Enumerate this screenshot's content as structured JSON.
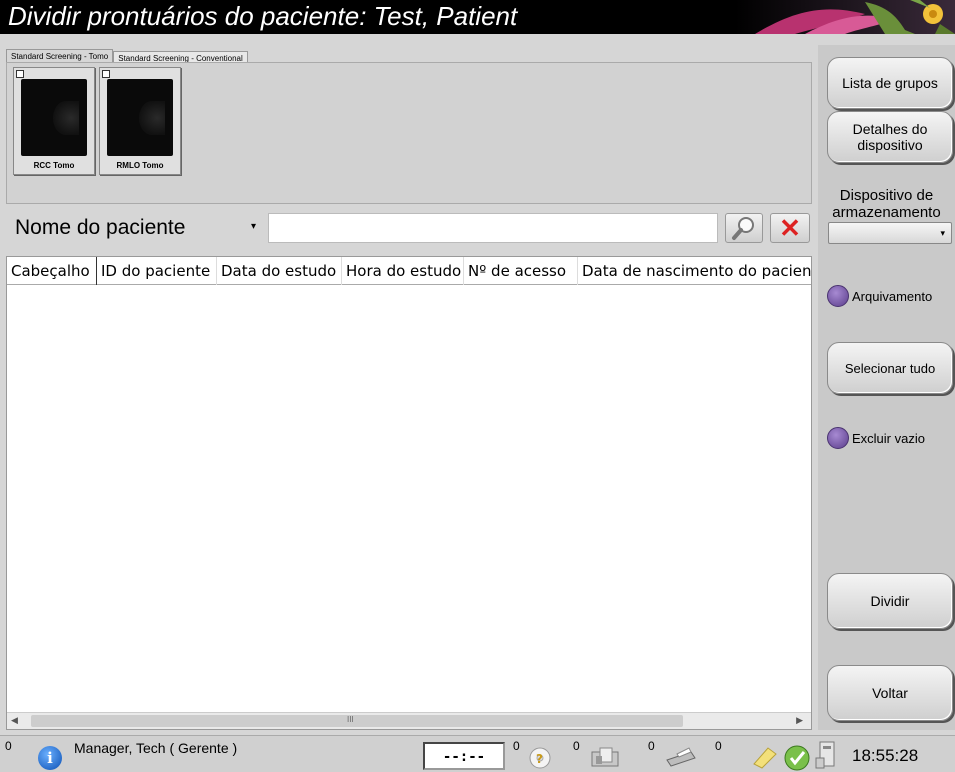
{
  "window": {
    "title": "Dividir prontuários do paciente: Test, Patient"
  },
  "tabs": [
    {
      "label": "Standard Screening - Tomo"
    },
    {
      "label": "Standard Screening - Conventional"
    }
  ],
  "thumbnails": [
    {
      "label": "RCC Tomo",
      "checked": false
    },
    {
      "label": "RMLO Tomo",
      "checked": false
    }
  ],
  "search": {
    "field_selected": "Nome do paciente",
    "value": "",
    "search_icon": "magnifier-icon",
    "clear_icon": "red-x-icon"
  },
  "table": {
    "columns": [
      "Cabeçalho",
      "ID do paciente",
      "Data do estudo",
      "Hora do estudo",
      "Nº de acesso",
      "Data de nascimento do paciente"
    ],
    "rows": [],
    "scrollbar_grip": "III"
  },
  "right_panel": {
    "group_list_label": "Lista de grupos",
    "device_details_label": "Detalhes do dispositivo",
    "storage_device_label": "Dispositivo de armazenamento",
    "storage_device_value": "",
    "archive_label": "Arquivamento",
    "select_all_label": "Selecionar tudo",
    "delete_empty_label": "Excluir vazio",
    "split_label": "Dividir",
    "back_label": "Voltar"
  },
  "status_bar": {
    "alerts_count": "0",
    "user": "Manager, Tech ( Gerente )",
    "timer": "--:--",
    "counts": [
      "0",
      "0",
      "0",
      "0"
    ],
    "time": "18:55:28"
  },
  "colors": {
    "radio": "#6a4b9c",
    "clear": "#dd2222",
    "title_bg": "#000000"
  }
}
